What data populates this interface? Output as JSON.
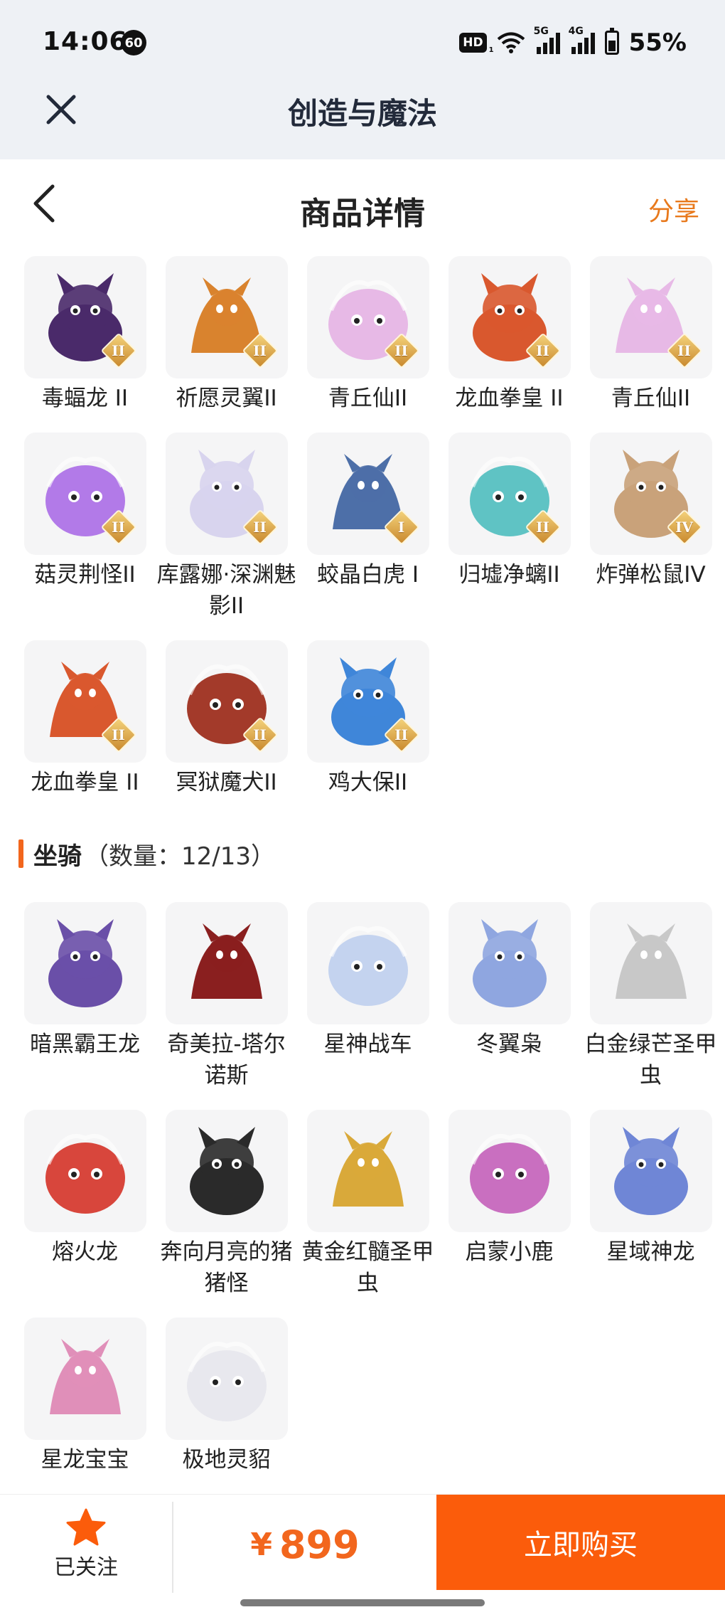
{
  "status_bar": {
    "time": "14:06",
    "badge": "60",
    "hd": "HD",
    "hd_sub": "1",
    "net1": "5G",
    "net2": "4G",
    "battery": "55%"
  },
  "appbar": {
    "title": "创造与魔法",
    "close_icon": "close-icon"
  },
  "page": {
    "title": "商品详情",
    "share": "分享",
    "back_icon": "chevron-left-icon"
  },
  "pets": [
    {
      "label": "毒蝠龙 II",
      "tier": "II",
      "color": "#4a2a6a"
    },
    {
      "label": "祈愿灵翼II",
      "tier": "II",
      "color": "#d9832e"
    },
    {
      "label": "青丘仙II",
      "tier": "II",
      "color": "#e7b9e6"
    },
    {
      "label": "龙血拳皇 II",
      "tier": "II",
      "color": "#d9582e"
    },
    {
      "label": "青丘仙II",
      "tier": "II",
      "color": "#e7b9e6"
    },
    {
      "label": "菇灵荆怪II",
      "tier": "II",
      "color": "#b27ae8"
    },
    {
      "label": "库露娜·深渊魅影II",
      "tier": "II",
      "color": "#d8d4ee"
    },
    {
      "label": "蛟晶白虎 I",
      "tier": "I",
      "color": "#4d6fa8"
    },
    {
      "label": "归墟净螭II",
      "tier": "II",
      "color": "#5fc3c4"
    },
    {
      "label": "炸弹松鼠IV",
      "tier": "IV",
      "color": "#c9a27a"
    },
    {
      "label": "龙血拳皇 II",
      "tier": "II",
      "color": "#d9582e"
    },
    {
      "label": "冥狱魔犬II",
      "tier": "II",
      "color": "#a33a2a"
    },
    {
      "label": "鸡大保II",
      "tier": "II",
      "color": "#3f86d9"
    }
  ],
  "mounts_section": {
    "title": "坐骑",
    "count": "（数量：12/13）",
    "accent": "#f2661d"
  },
  "mounts": [
    {
      "label": "暗黑霸王龙",
      "color": "#6a4fa8"
    },
    {
      "label": "奇美拉-塔尔诺斯",
      "color": "#8a1f1f"
    },
    {
      "label": "星神战车",
      "color": "#c4d3ef"
    },
    {
      "label": "冬翼枭",
      "color": "#8fa6e0"
    },
    {
      "label": "白金绿芒圣甲虫",
      "color": "#c8c8c8"
    },
    {
      "label": "熔火龙",
      "color": "#d8463c"
    },
    {
      "label": "奔向月亮的猪猪怪",
      "color": "#2a2a2a"
    },
    {
      "label": "黄金红髓圣甲虫",
      "color": "#d9a93a"
    },
    {
      "label": "启蒙小鹿",
      "color": "#c96fc0"
    },
    {
      "label": "星域神龙",
      "color": "#6f86d6"
    },
    {
      "label": "星龙宝宝",
      "color": "#e08fb9"
    },
    {
      "label": "极地灵貂",
      "color": "#e8e8ee"
    }
  ],
  "bottom": {
    "follow_label": "已关注",
    "follow_icon": "star-icon",
    "currency": "¥",
    "price": "899",
    "buy_label": "立即购买",
    "accent": "#fb5c0b"
  }
}
